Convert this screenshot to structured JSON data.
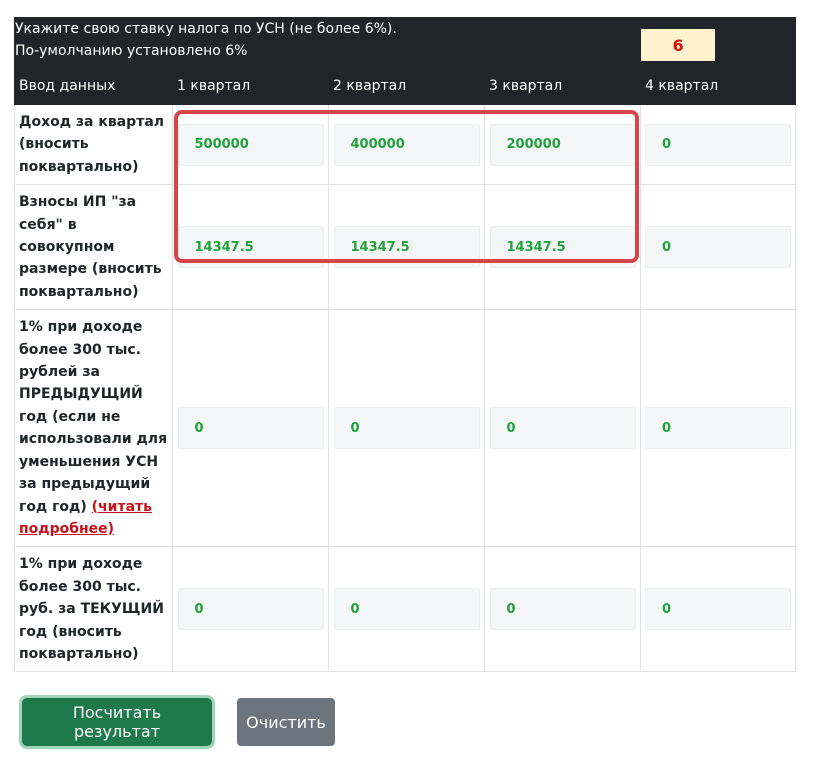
{
  "rate": {
    "prompt_line1": "Укажите свою ставку налога по УСН (не более 6%).",
    "prompt_line2": "По-умолчанию установлено 6%",
    "value": "6"
  },
  "header": {
    "label": "Ввод данных",
    "quarters": [
      "1 квартал",
      "2 квартал",
      "3 квартал",
      "4 квартал"
    ]
  },
  "rows": [
    {
      "label": "Доход за квартал (вносить поквартально)",
      "values": [
        "500000",
        "400000",
        "200000",
        "0"
      ]
    },
    {
      "label": "Взносы ИП \"за себя\" в совокупном размере (вносить поквартально)",
      "values": [
        "14347.5",
        "14347.5",
        "14347.5",
        "0"
      ]
    },
    {
      "label": "1% при доходе более 300 тыс. рублей за ПРЕДЫДУЩИЙ год (если не использовали для уменьшения УСН за предыдущий год год)",
      "link": "(читать подробнее)",
      "values": [
        "0",
        "0",
        "0",
        "0"
      ]
    },
    {
      "label": "1% при доходе более 300 тыс. руб. за ТЕКУЩИЙ год (вносить поквартально)",
      "values": [
        "0",
        "0",
        "0",
        "0"
      ]
    }
  ],
  "buttons": {
    "calculate": "Посчитать результат",
    "clear": "Очистить"
  },
  "colors": {
    "header_bg": "#212529",
    "rate_bg": "#fff3cd",
    "rate_text": "#d9120d",
    "value_text": "#1fa33a",
    "highlight": "#d6454a",
    "calc_button": "#1f7a4b",
    "clear_button": "#6c757d"
  }
}
